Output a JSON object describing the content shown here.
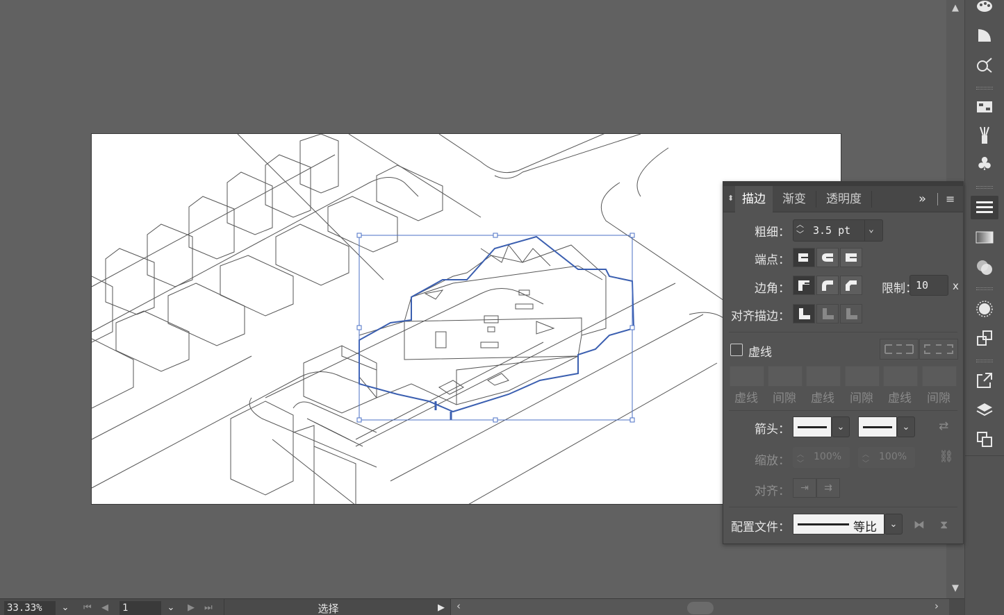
{
  "canvas": {
    "zoom": "33.33%",
    "page": "1",
    "tool_status": "选择"
  },
  "panel": {
    "tabs": [
      "描边",
      "渐变",
      "透明度"
    ],
    "weight_label": "粗细：",
    "weight_value": "3.5 pt",
    "cap_label": "端点：",
    "corner_label": "边角：",
    "limit_label": "限制：",
    "limit_value": "10",
    "limit_unit": "x",
    "align_label": "对齐描边：",
    "dashed_label": "虚线",
    "dash_labels": [
      "虚线",
      "间隙",
      "虚线",
      "间隙",
      "虚线",
      "间隙"
    ],
    "arrow_label": "箭头：",
    "scale_label": "缩放：",
    "scale_start": "100%",
    "scale_end": "100%",
    "arrow_align_label": "对齐：",
    "profile_label": "配置文件：",
    "profile_value": "等比"
  },
  "colors": {
    "selection": "#3b5fb0",
    "panel_bg": "#535353",
    "canvas_bg": "#616161"
  }
}
